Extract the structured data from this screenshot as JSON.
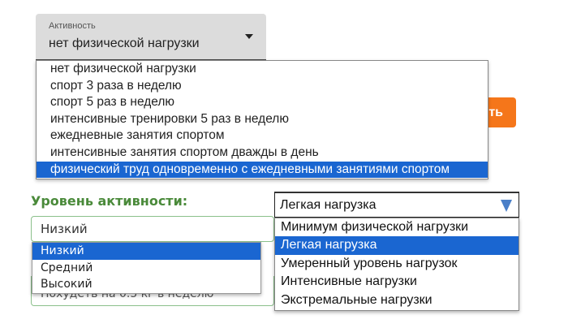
{
  "activity": {
    "label": "Активность",
    "value": "нет физической нагрузки",
    "options": [
      "нет физической нагрузки",
      "спорт 3 раза в неделю",
      "спорт 5 раз в неделю",
      "интенсивные тренировки 5 раз в неделю",
      "ежедневные занятия спортом",
      "интенсивные занятия спортом дважды в день",
      "физический труд одновременно с ежедневными занятиями спортом"
    ]
  },
  "calculate_button": {
    "label": "ть"
  },
  "level": {
    "label": "Уровень активности:",
    "value": "Низкий",
    "options": [
      "Низкий",
      "Средний",
      "Высокий"
    ]
  },
  "goal": {
    "value": "Похудеть на 0.5 кг в неделю"
  },
  "load": {
    "value": "Легкая нагрузка",
    "options": [
      "Минимум физической нагрузки",
      "Легкая нагрузка",
      "Умеренный уровень нагрузок",
      "Интенсивные нагрузки",
      "Экстремальные нагрузки"
    ]
  },
  "colors": {
    "accent": "#1a66d1",
    "button": "#f5761a",
    "label_green": "#4a8a3a"
  }
}
